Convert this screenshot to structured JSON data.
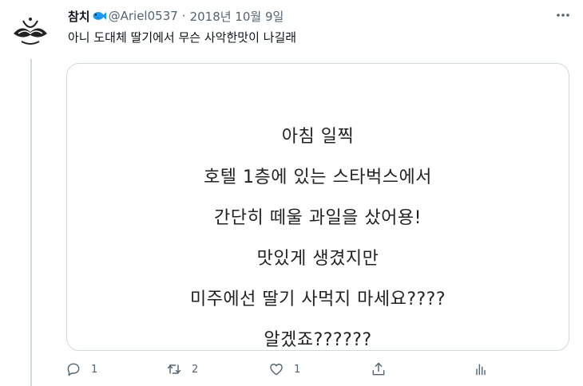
{
  "tweet": {
    "display_name": "참치",
    "handle": "@Ariel0537",
    "separator": "·",
    "date": "2018년 10월 9일",
    "text": "아니 도대체 딸기에서 무슨 사악한맛이 나길래"
  },
  "media": {
    "lines": [
      "아침 일찍",
      "호텔 1층에 있는 스타벅스에서",
      "간단히 떼울 과일을 샀어용!",
      "맛있게 생겼지만",
      "미주에선 딸기 사먹지 마세요????",
      "알겠죠??????"
    ]
  },
  "actions": {
    "reply_count": "1",
    "retweet_count": "2",
    "like_count": "1"
  },
  "colors": {
    "text": "#0f1419",
    "secondary": "#536471",
    "border": "#cfd9de",
    "fish": "#1d9bf0"
  },
  "icons": [
    "fish-icon",
    "more-icon",
    "reply-icon",
    "retweet-icon",
    "like-icon",
    "share-icon",
    "analytics-icon"
  ]
}
